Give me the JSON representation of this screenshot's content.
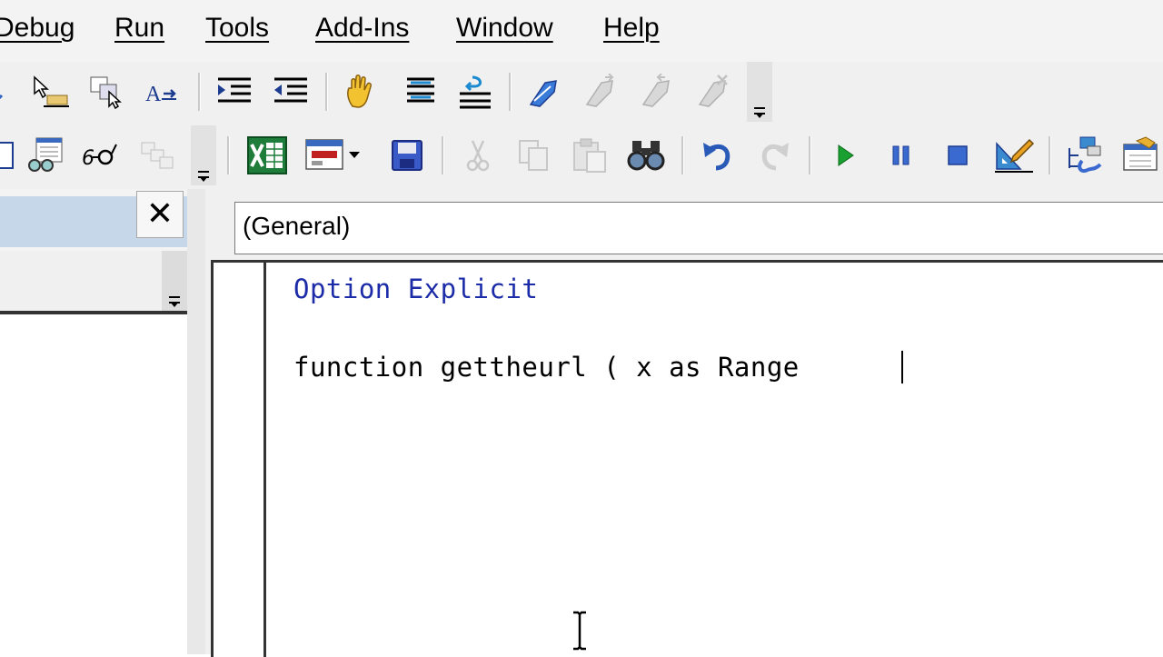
{
  "menu": {
    "items": [
      "Debug",
      "Run",
      "Tools",
      "Add-Ins",
      "Window",
      "Help"
    ]
  },
  "toolbar_edit": {
    "icons": [
      "list-properties-icon",
      "list-constants-icon",
      "quick-info-icon",
      "parameter-info-icon",
      "complete-word-icon",
      "indent-icon",
      "outdent-icon",
      "toggle-breakpoint-icon",
      "comment-block-icon",
      "uncomment-block-icon",
      "toggle-bookmark-icon",
      "next-bookmark-icon",
      "previous-bookmark-icon",
      "clear-bookmarks-icon"
    ]
  },
  "toolbar_standard": {
    "icons": [
      "view-code-icon",
      "object-browser-icon",
      "watch-icon",
      "call-stack-icon",
      "view-excel-icon",
      "insert-userform-icon",
      "save-icon",
      "cut-icon",
      "copy-icon",
      "paste-icon",
      "find-icon",
      "undo-icon",
      "redo-icon",
      "run-icon",
      "break-icon",
      "reset-icon",
      "design-mode-icon",
      "project-explorer-icon",
      "properties-icon"
    ]
  },
  "project_panel": {
    "close_glyph": "✕"
  },
  "code_window": {
    "object_combo_value": "(General)",
    "lines": [
      {
        "text": "Option Explicit",
        "style": "keyword"
      },
      {
        "text": "function gettheurl ( x as Range",
        "style": "plain"
      }
    ]
  },
  "colors": {
    "keyword": "#1c2ca8",
    "title_bar": "#c7d7ea",
    "toolbar_bg": "#f0f0f0"
  }
}
